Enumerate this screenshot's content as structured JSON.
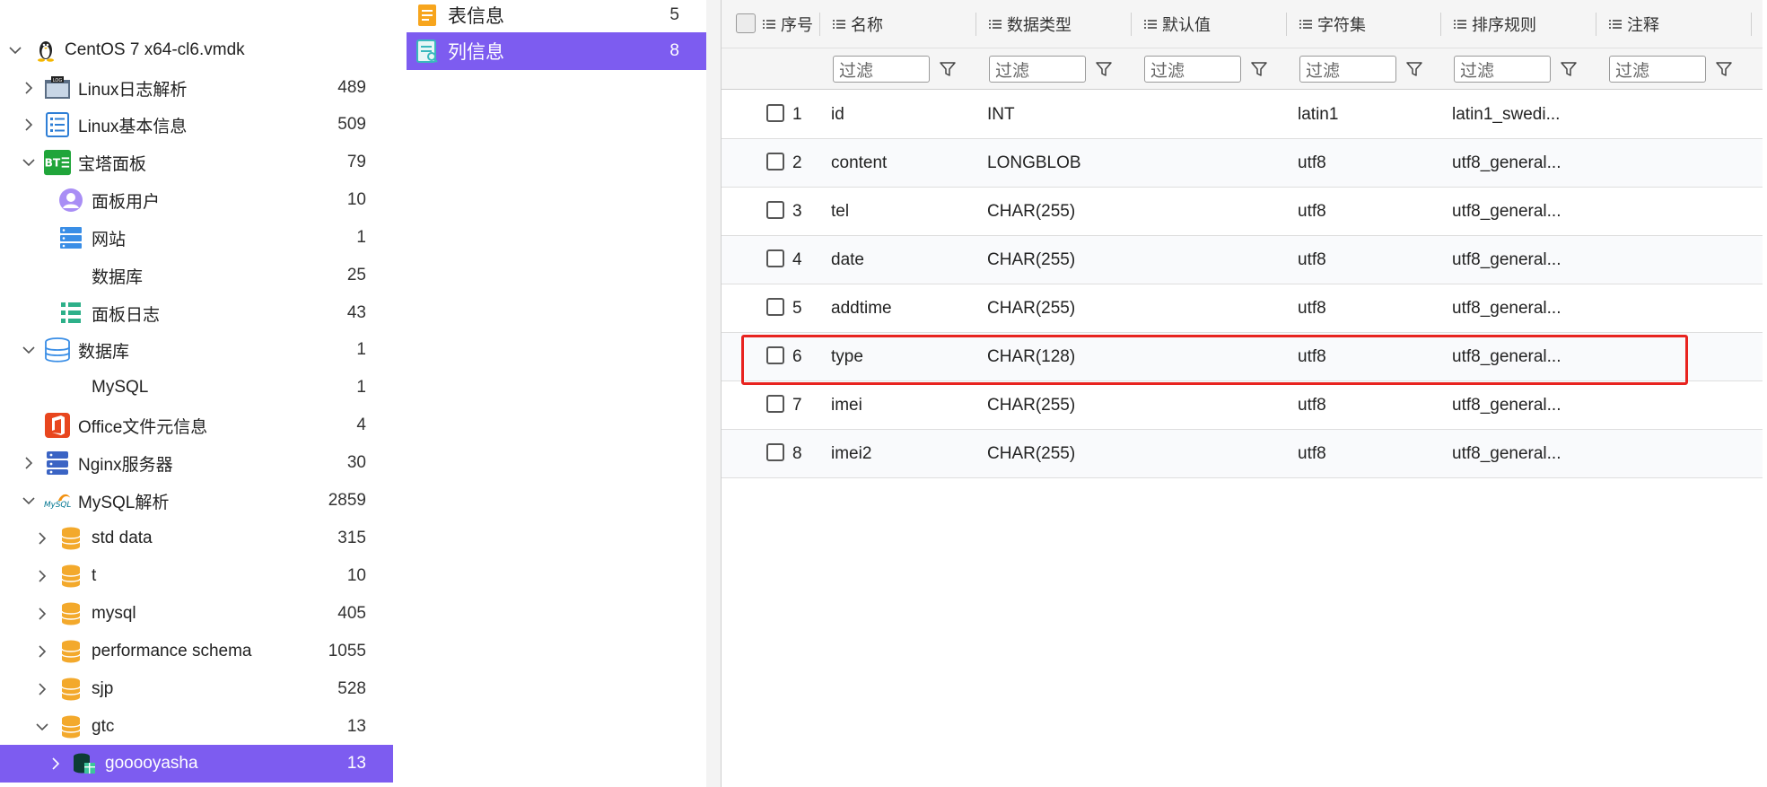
{
  "tree": {
    "items": [
      {
        "label": "CentOS 7 x64-cl6.vmdk",
        "count": "",
        "arrow": "down",
        "icon": "linux-penguin-icon"
      },
      {
        "label": "Linux日志解析",
        "count": "489",
        "arrow": "right",
        "icon": "log-icon"
      },
      {
        "label": "Linux基本信息",
        "count": "509",
        "arrow": "right",
        "icon": "list-info-icon"
      },
      {
        "label": "宝塔面板",
        "count": "79",
        "arrow": "down",
        "icon": "bt-panel-icon"
      },
      {
        "label": "面板用户",
        "count": "10",
        "arrow": "",
        "icon": "user-icon"
      },
      {
        "label": "网站",
        "count": "1",
        "arrow": "",
        "icon": "server-icon"
      },
      {
        "label": "数据库",
        "count": "25",
        "arrow": "",
        "icon": ""
      },
      {
        "label": "面板日志",
        "count": "43",
        "arrow": "",
        "icon": "log-list-icon"
      },
      {
        "label": "数据库",
        "count": "1",
        "arrow": "down",
        "icon": "database-icon"
      },
      {
        "label": "MySQL",
        "count": "1",
        "arrow": "",
        "icon": ""
      },
      {
        "label": "Office文件元信息",
        "count": "4",
        "arrow": "",
        "icon": "office-icon"
      },
      {
        "label": "Nginx服务器",
        "count": "30",
        "arrow": "right",
        "icon": "nginx-server-icon"
      },
      {
        "label": "MySQL解析",
        "count": "2859",
        "arrow": "down",
        "icon": "mysql-logo-icon"
      },
      {
        "label": "std data",
        "count": "315",
        "arrow": "right",
        "icon": "db-cylinder-icon"
      },
      {
        "label": "t",
        "count": "10",
        "arrow": "right",
        "icon": "db-cylinder-icon"
      },
      {
        "label": "mysql",
        "count": "405",
        "arrow": "right",
        "icon": "db-cylinder-icon"
      },
      {
        "label": "performance schema",
        "count": "1055",
        "arrow": "right",
        "icon": "db-cylinder-icon"
      },
      {
        "label": "sjp",
        "count": "528",
        "arrow": "right",
        "icon": "db-cylinder-icon"
      },
      {
        "label": "gtc",
        "count": "13",
        "arrow": "down",
        "icon": "db-cylinder-icon"
      },
      {
        "label": "gooooyasha",
        "count": "13",
        "arrow": "right",
        "icon": "table-db-icon",
        "selected": true
      }
    ]
  },
  "middle": {
    "items": [
      {
        "label": "表信息",
        "count": "5",
        "icon": "table-info-icon"
      },
      {
        "label": "列信息",
        "count": "8",
        "icon": "column-info-icon",
        "selected": true
      }
    ]
  },
  "grid": {
    "headers": [
      "序号",
      "名称",
      "数据类型",
      "默认值",
      "字符集",
      "排序规则",
      "注释"
    ],
    "filter_placeholder": "过滤",
    "rows": [
      {
        "no": "1",
        "name": "id",
        "type": "INT",
        "default": "",
        "charset": "latin1",
        "collation": "latin1_swedi...",
        "comment": ""
      },
      {
        "no": "2",
        "name": "content",
        "type": "LONGBLOB",
        "default": "",
        "charset": "utf8",
        "collation": "utf8_general...",
        "comment": ""
      },
      {
        "no": "3",
        "name": "tel",
        "type": "CHAR(255)",
        "default": "",
        "charset": "utf8",
        "collation": "utf8_general...",
        "comment": ""
      },
      {
        "no": "4",
        "name": "date",
        "type": "CHAR(255)",
        "default": "",
        "charset": "utf8",
        "collation": "utf8_general...",
        "comment": ""
      },
      {
        "no": "5",
        "name": "addtime",
        "type": "CHAR(255)",
        "default": "",
        "charset": "utf8",
        "collation": "utf8_general...",
        "comment": ""
      },
      {
        "no": "6",
        "name": "type",
        "type": "CHAR(128)",
        "default": "",
        "charset": "utf8",
        "collation": "utf8_general...",
        "comment": ""
      },
      {
        "no": "7",
        "name": "imei",
        "type": "CHAR(255)",
        "default": "",
        "charset": "utf8",
        "collation": "utf8_general...",
        "comment": ""
      },
      {
        "no": "8",
        "name": "imei2",
        "type": "CHAR(255)",
        "default": "",
        "charset": "utf8",
        "collation": "utf8_general...",
        "comment": ""
      }
    ],
    "highlighted_row": "6"
  },
  "colors": {
    "selection": "#7d5cf0",
    "highlight_border": "#e8231f",
    "header_bg": "#f5f5f5"
  }
}
